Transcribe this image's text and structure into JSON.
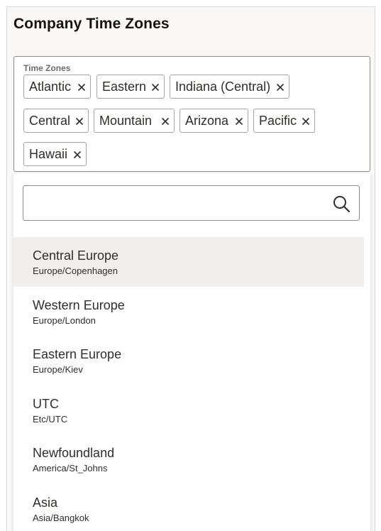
{
  "header": {
    "title": "Company Time Zones"
  },
  "field": {
    "label": "Time Zones",
    "chips": [
      {
        "label": "Atlantic"
      },
      {
        "label": "Eastern"
      },
      {
        "label": "Indiana (Central)"
      },
      {
        "label": "Central"
      },
      {
        "label": "Mountain"
      },
      {
        "label": "Arizona"
      },
      {
        "label": "Pacific"
      },
      {
        "label": "Hawaii"
      }
    ]
  },
  "search": {
    "value": "",
    "placeholder": "",
    "icon": "search-icon"
  },
  "options": [
    {
      "label": "Central Europe",
      "sub": "Europe/Copenhagen"
    },
    {
      "label": "Western Europe",
      "sub": "Europe/London"
    },
    {
      "label": "Eastern Europe",
      "sub": "Europe/Kiev"
    },
    {
      "label": "UTC",
      "sub": "Etc/UTC"
    },
    {
      "label": "Newfoundland",
      "sub": "America/St_Johns"
    },
    {
      "label": "Asia",
      "sub": "Asia/Bangkok"
    }
  ],
  "colors": {
    "highlight": "#f1efed",
    "text": "#312d2a",
    "border": "#8f8b86"
  }
}
